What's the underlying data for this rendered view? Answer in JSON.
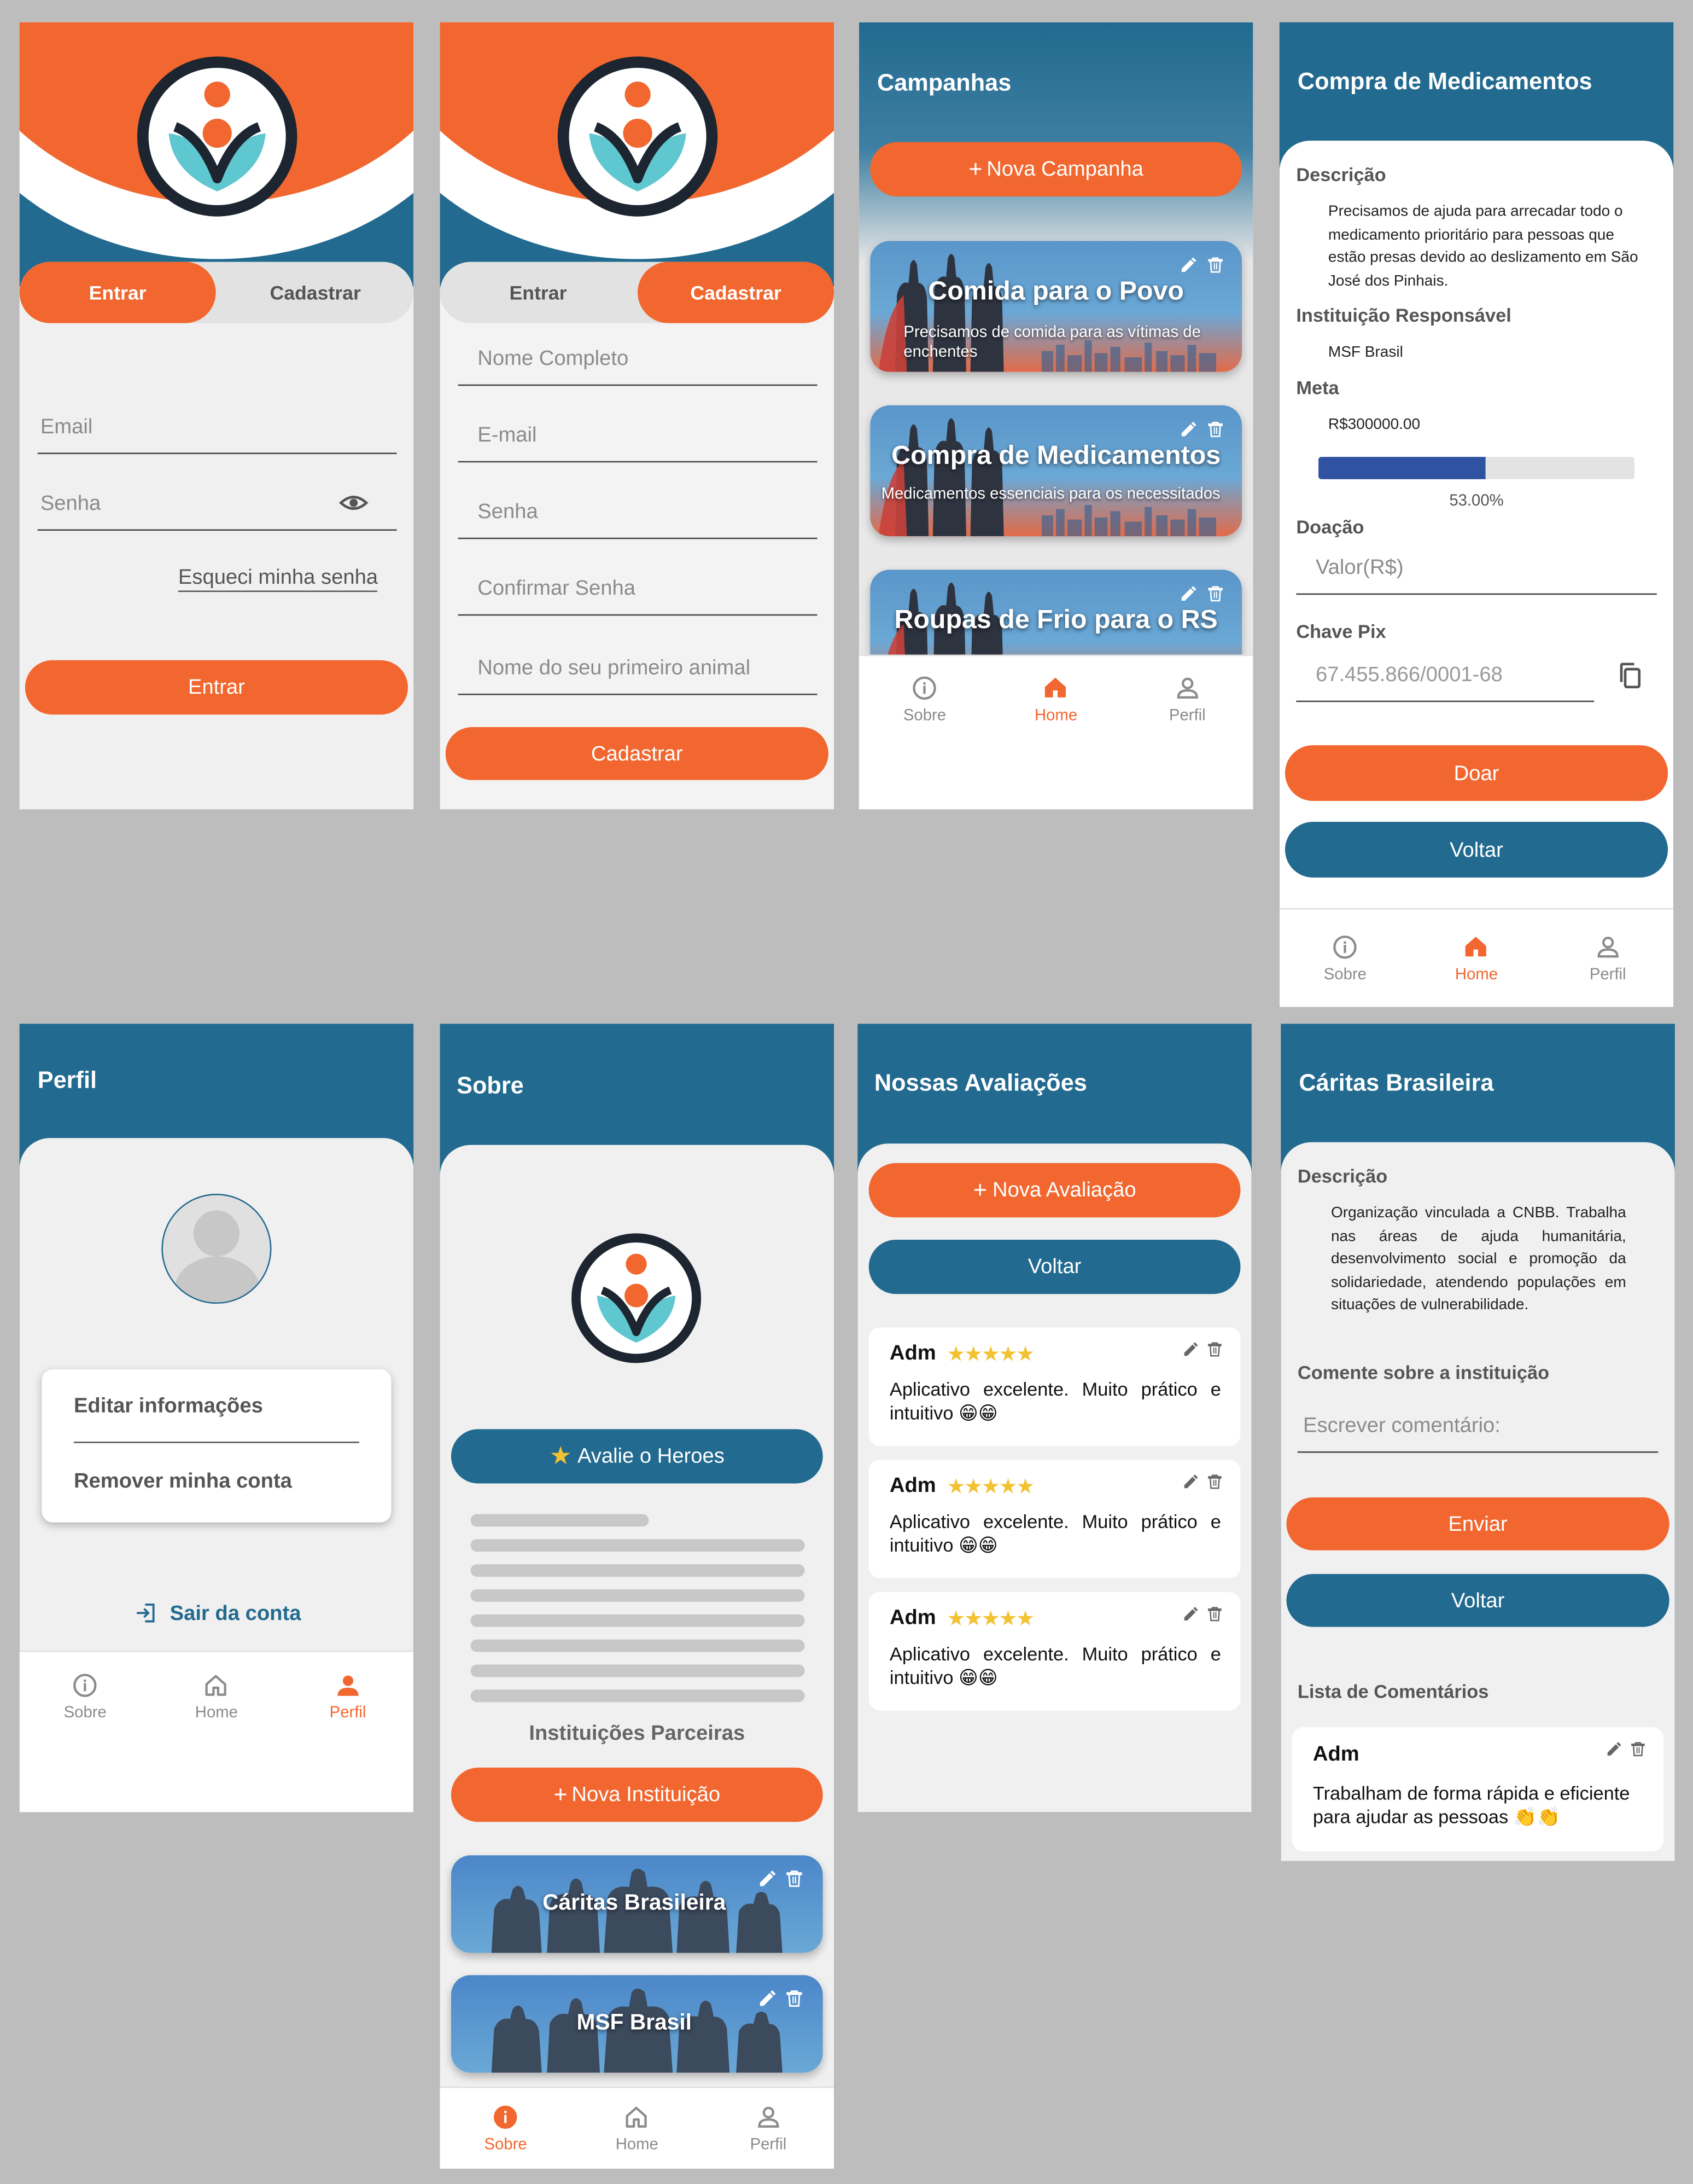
{
  "colors": {
    "orange": "#f2672f",
    "blue": "#226a8f",
    "background": "#bdbdbd"
  },
  "login": {
    "tab_login": "Entrar",
    "tab_register": "Cadastrar",
    "email_placeholder": "Email",
    "password_placeholder": "Senha",
    "forgot_password": "Esqueci minha senha",
    "submit": "Entrar"
  },
  "register": {
    "tab_login": "Entrar",
    "tab_register": "Cadastrar",
    "fields": [
      "Nome Completo",
      "E-mail",
      "Senha",
      "Confirmar Senha",
      "Nome do seu primeiro animal"
    ],
    "submit": "Cadastrar"
  },
  "campaigns": {
    "title": "Campanhas",
    "new_button": "Nova Campanha",
    "items": [
      {
        "title": "Comida para o Povo",
        "subtitle": "Precisamos de comida para as vítimas de enchentes"
      },
      {
        "title": "Compra de Medicamentos",
        "subtitle": "Medicamentos essenciais para os necessitados"
      },
      {
        "title": "Roupas de Frio para o RS",
        "subtitle": ""
      }
    ]
  },
  "nav": {
    "about": "Sobre",
    "home": "Home",
    "profile": "Perfil"
  },
  "detail": {
    "title": "Compra de Medicamentos",
    "description_label": "Descrição",
    "description": "Precisamos de ajuda para arrecadar todo o medicamento prioritário para pessoas que estão presas devido ao deslizamento em São José dos Pinhais.",
    "institution_label": "Instituição Responsável",
    "institution": "MSF Brasil",
    "goal_label": "Meta",
    "goal": "R$300000.00",
    "progress": 0.53,
    "progress_text": "53.00%",
    "donation_label": "Doação",
    "donation_placeholder": "Valor(R$)",
    "pix_label": "Chave Pix",
    "pix_value": "67.455.866/0001-68",
    "donate_button": "Doar",
    "back_button": "Voltar"
  },
  "profile": {
    "title": "Perfil",
    "edit_info": "Editar informações",
    "remove_account": "Remover minha conta",
    "logout": "Sair da conta"
  },
  "about": {
    "title": "Sobre",
    "rate_button": "Avalie o Heroes",
    "partners_title": "Instituições Parceiras",
    "new_institution": "Nova Instituição",
    "institutions": [
      "Cáritas Brasileira",
      "MSF Brasil"
    ]
  },
  "reviews": {
    "title": "Nossas Avaliações",
    "new_review": "Nova Avaliação",
    "back_button": "Voltar",
    "items": [
      {
        "author": "Adm",
        "stars": "★★★★★",
        "text": "Aplicativo excelente. Muito prático e intuitivo 😁😁"
      },
      {
        "author": "Adm",
        "stars": "★★★★★",
        "text": "Aplicativo excelente. Muito prático e intuitivo 😁😁"
      },
      {
        "author": "Adm",
        "stars": "★★★★★",
        "text": "Aplicativo excelente. Muito prático e intuitivo 😁😁"
      }
    ]
  },
  "institution": {
    "title": "Cáritas Brasileira",
    "description_label": "Descrição",
    "description": "Organização vinculada a CNBB. Trabalha nas áreas de ajuda humanitária, desenvolvimento social e promoção da solidariedade, atendendo populações em situações de vulnerabilidade.",
    "comment_label": "Comente sobre a instituição",
    "comment_placeholder": "Escrever comentário:",
    "send_button": "Enviar",
    "back_button": "Voltar",
    "comments_label": "Lista de Comentários",
    "comment": {
      "author": "Adm",
      "text": "Trabalham de forma rápida e eficiente para ajudar as pessoas 👏👏"
    }
  }
}
